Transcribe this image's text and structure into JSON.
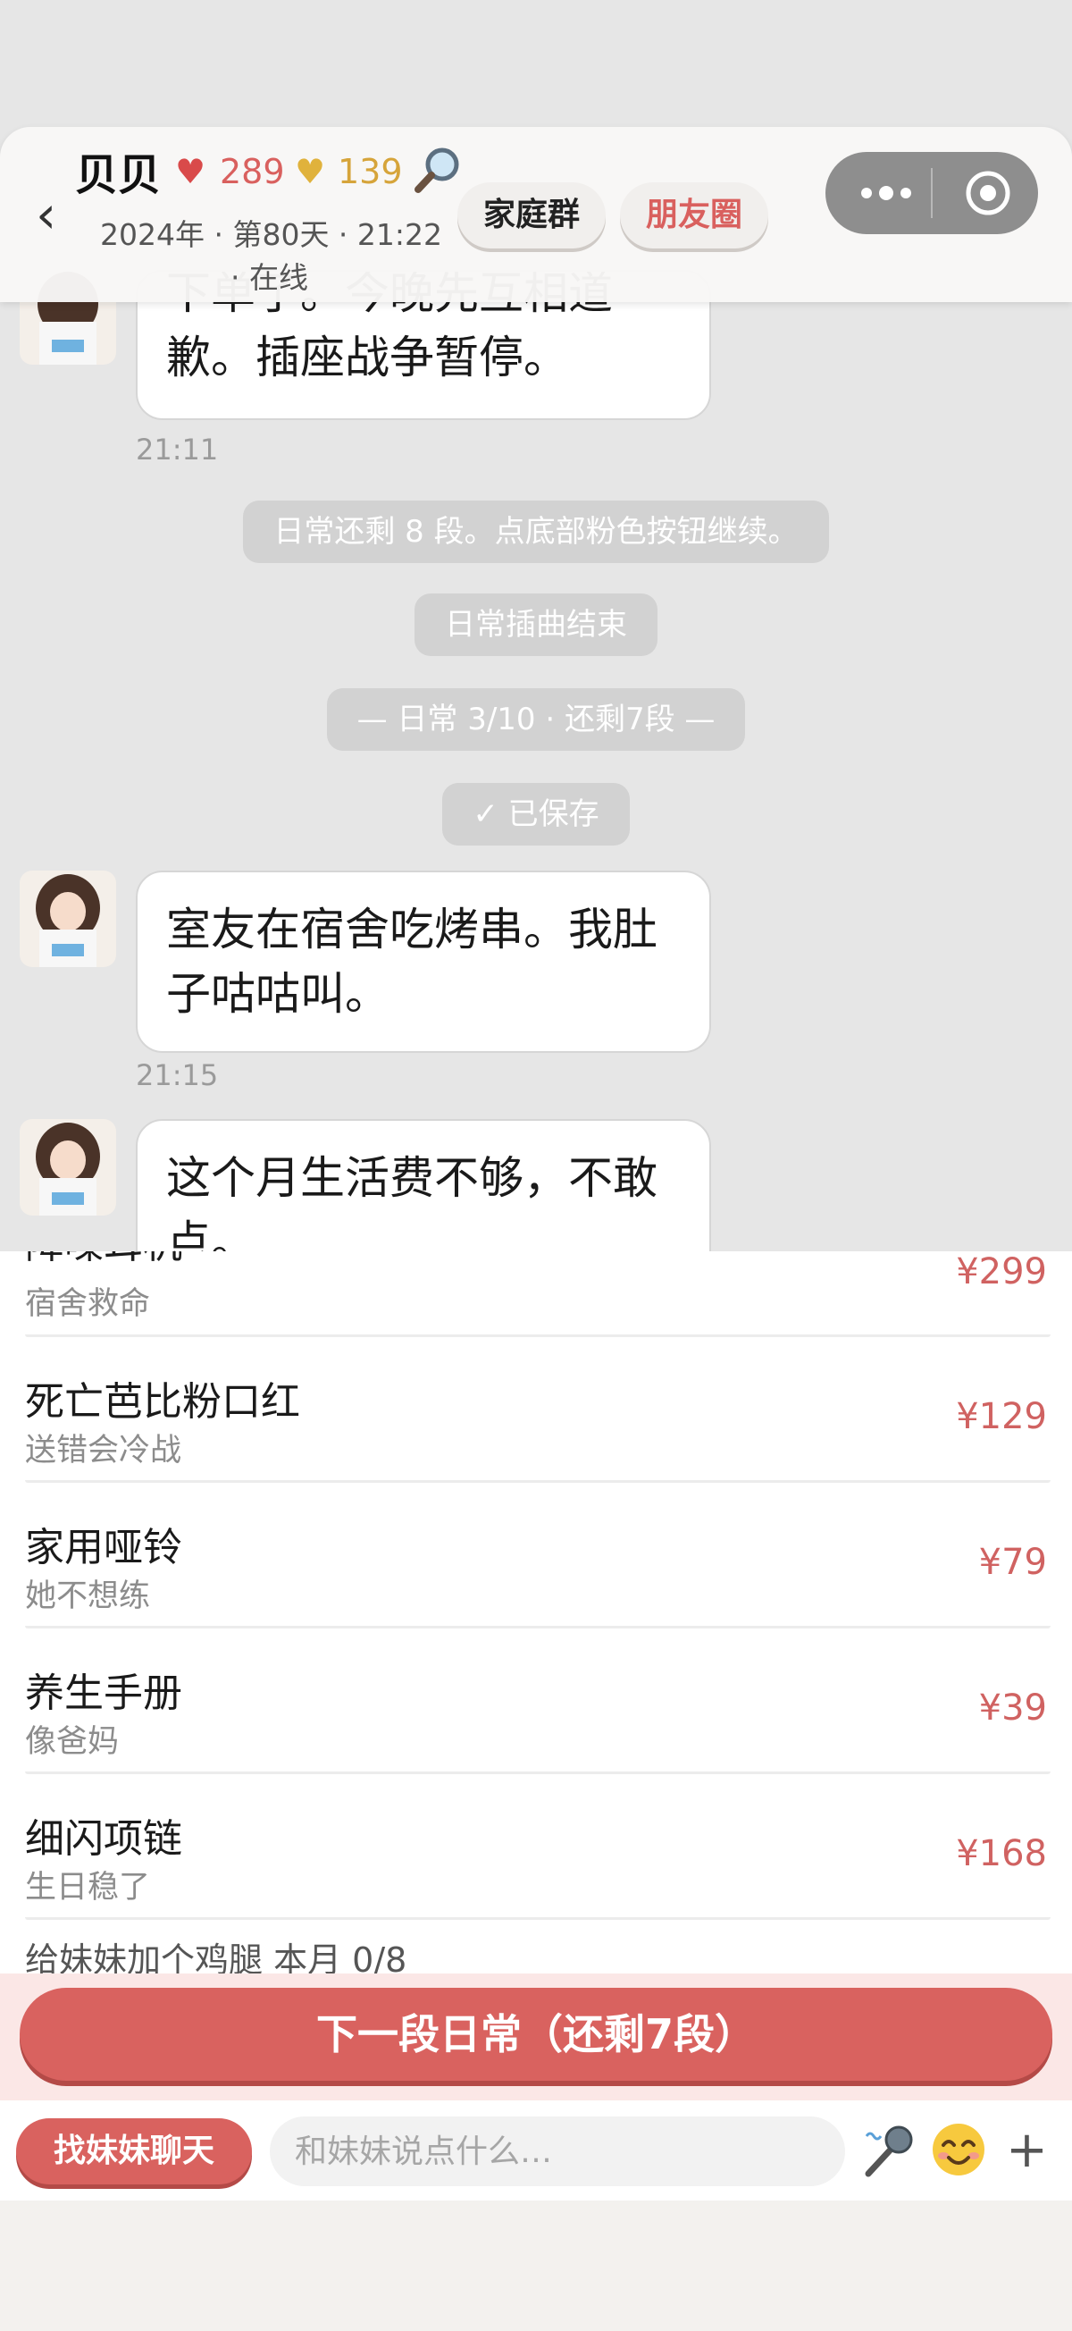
{
  "header": {
    "back_icon": "‹",
    "name": "贝贝",
    "red_heart_icon": "♥",
    "red_heart_count": "289",
    "gold_heart_icon": "♥",
    "gold_heart_count": "139",
    "subtitle": "2024年 · 第80天 · 21:22",
    "online": "· 在线",
    "family_group": "家庭群",
    "moments": "朋友圈",
    "colors": {
      "red_heart": "#d94a4a",
      "gold_heart": "#e0b23c",
      "accent": "#d9605e"
    }
  },
  "chat": {
    "msg1": "下单了。今晚先互相道歉。插座战争暂停。",
    "time1": "21:11",
    "sys1": "日常还剩 8 段。点底部粉色按钮继续。",
    "sys2": "日常插曲结束",
    "sys3": "— 日常 3/10 · 还剩7段 —",
    "sys4": "✓ 已保存",
    "msg2": "室友在宿舍吃烤串。我肚子咕咕叫。",
    "time2": "21:15",
    "msg3": "这个月生活费不够，不敢点。"
  },
  "gifts": {
    "items": [
      {
        "name": "降噪耳机",
        "desc": "宿舍救命",
        "price": "¥299"
      },
      {
        "name": "死亡芭比粉口红",
        "desc": "送错会冷战",
        "price": "¥129"
      },
      {
        "name": "家用哑铃",
        "desc": "她不想练",
        "price": "¥79"
      },
      {
        "name": "养生手册",
        "desc": "像爸妈",
        "price": "¥39"
      },
      {
        "name": "细闪项链",
        "desc": "生日稳了",
        "price": "¥168"
      }
    ],
    "quota": "给妹妹加个鸡腿  本月 0/8"
  },
  "next_button": "下一段日常（还剩7段）",
  "input_bar": {
    "chat_button": "找妹妹聊天",
    "placeholder": "和妹妹说点什么…",
    "plus": "+"
  }
}
